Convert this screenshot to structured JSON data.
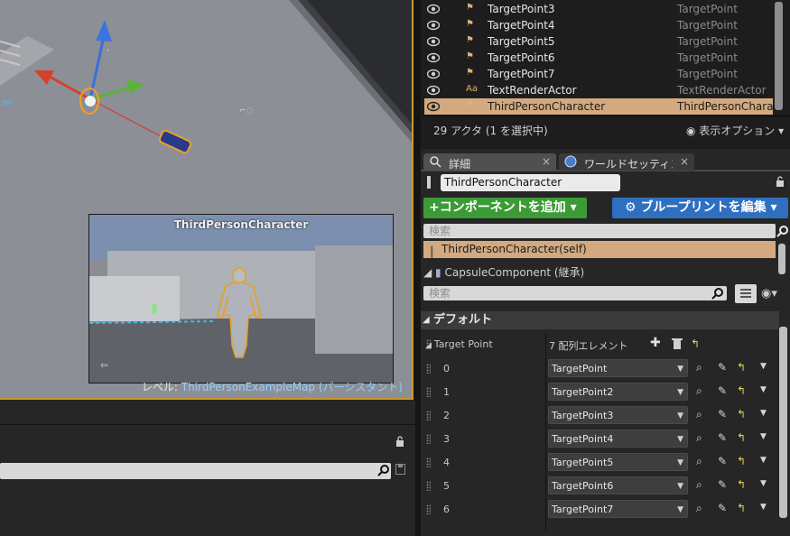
{
  "viewport": {
    "pip_title": "ThirdPersonCharacter",
    "level_prefix": "レベル: ",
    "level_name": "ThirdPersonExampleMap (パーシスタント)",
    "edge_text": "m"
  },
  "outliner": {
    "rows": [
      {
        "name": "TargetPoint3",
        "type": "TargetPoint",
        "icon": "target-point-icon"
      },
      {
        "name": "TargetPoint4",
        "type": "TargetPoint",
        "icon": "target-point-icon"
      },
      {
        "name": "TargetPoint5",
        "type": "TargetPoint",
        "icon": "target-point-icon"
      },
      {
        "name": "TargetPoint6",
        "type": "TargetPoint",
        "icon": "target-point-icon"
      },
      {
        "name": "TargetPoint7",
        "type": "TargetPoint",
        "icon": "target-point-icon"
      },
      {
        "name": "TextRenderActor",
        "type": "TextRenderActor",
        "icon": "text-render-icon",
        "glyph": "Aa"
      },
      {
        "name": "ThirdPersonCharacter",
        "type": "ThirdPersonCharac",
        "icon": "character-icon",
        "selected": true
      }
    ],
    "count_label": "29 アクタ (1 を選択中)",
    "view_options": "表示オプション"
  },
  "details": {
    "tabs": [
      {
        "label": "詳細",
        "close": "×"
      },
      {
        "label": "ワールドセッティンク",
        "close": "×"
      }
    ],
    "actor_name": "ThirdPersonCharacter",
    "add_component": "+コンポーネントを追加",
    "edit_blueprint": "ブループリントを編集",
    "search_placeholder": "検索",
    "components": [
      {
        "label": "ThirdPersonCharacter(self)"
      },
      {
        "label": "CapsuleComponent (継承)"
      }
    ],
    "category": "デフォルト",
    "array": {
      "label": "Target Point",
      "summary": "7 配列エレメント",
      "items": [
        {
          "index": "0",
          "value": "TargetPoint"
        },
        {
          "index": "1",
          "value": "TargetPoint2"
        },
        {
          "index": "2",
          "value": "TargetPoint3"
        },
        {
          "index": "3",
          "value": "TargetPoint4"
        },
        {
          "index": "4",
          "value": "TargetPoint5"
        },
        {
          "index": "5",
          "value": "TargetPoint6"
        },
        {
          "index": "6",
          "value": "TargetPoint7"
        }
      ]
    }
  },
  "colors": {
    "selection": "#d3aa80",
    "add_button": "#3c9b36",
    "blueprint_button": "#2e6fc0",
    "viewport_border": "#c89a2e"
  }
}
